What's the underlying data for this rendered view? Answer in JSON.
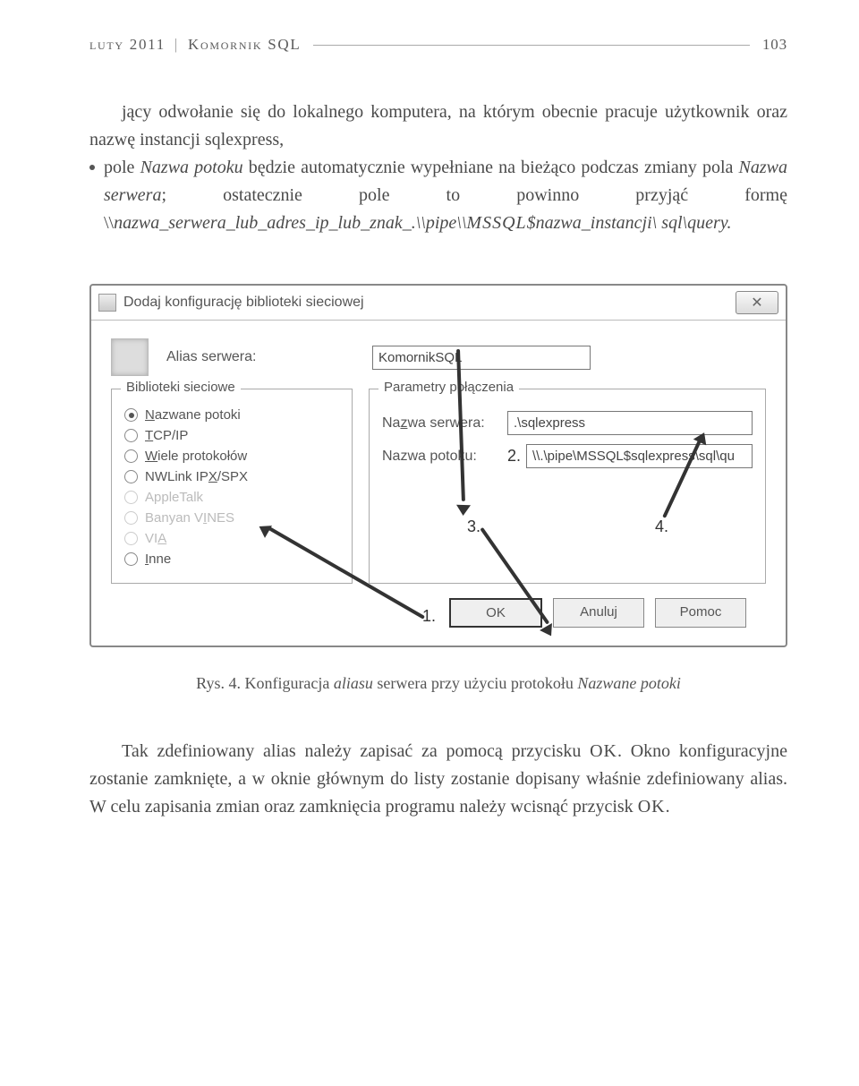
{
  "header": {
    "left": "luty 2011",
    "sep": "|",
    "title": "Komornik SQL",
    "page": "103"
  },
  "para1": "jący odwołanie się do lokalnego komputera, na którym obecnie pracuje użytkownik oraz nazwę instancji sqlexpress,",
  "bullet2_a": "pole ",
  "bullet2_b": "Nazwa potoku",
  "bullet2_c": " będzie automatycznie wypełniane na bieżąco podczas zmiany pola ",
  "bullet2_d": "Nazwa serwera",
  "bullet2_e": "; ostatecznie pole to powinno przyjąć formę \\\\",
  "bullet2_f": "nazwa_serwera_lub_adres_ip_lub_znak_.",
  "bullet2_g": "\\\\pipe\\\\",
  "bullet2_h": "MSSQL",
  "bullet2_i": "$nazwa_instancji",
  "bullet2_j": "\\ sql\\query.",
  "dialog": {
    "title": "Dodaj konfigurację biblioteki sieciowej",
    "aliasLabel": "Alias serwera:",
    "aliasValue": "KomornikSQL",
    "libsLegend": "Biblioteki sieciowe",
    "radios": {
      "r1": "Nazwane potoki",
      "r2": "TCP/IP",
      "r3": "Wiele protokołów",
      "r4": "NWLink IPX/SPX",
      "r5": "AppleTalk",
      "r6": "Banyan VINES",
      "r7": "VIA",
      "r8": "Inne"
    },
    "paramsLegend": "Parametry połączenia",
    "serverLabel": "Nazwa serwera:",
    "serverValue": ".\\sqlexpress",
    "pipeLabel": "Nazwa potoku:",
    "pipeValue": "\\\\.\\pipe\\MSSQL$sqlexpress\\sql\\qu",
    "ok": "OK",
    "cancel": "Anuluj",
    "help": "Pomoc",
    "ann1": "1.",
    "ann2": "2.",
    "ann3": "3.",
    "ann4": "4."
  },
  "caption_a": "Rys. 4. Konfiguracja ",
  "caption_b": "aliasu",
  "caption_c": " serwera przy użyciu protokołu ",
  "caption_d": "Nazwane potoki",
  "para2_a": "Tak zdefiniowany alias należy zapisać za pomocą przycisku ",
  "para2_b": "OK",
  "para2_c": ". Okno konfiguracyjne zostanie zamknięte, a w oknie głównym do listy zostanie dopisany właśnie zdefiniowany alias. W celu zapisania zmian oraz zamknięcia programu należy wcisnąć przycisk ",
  "para2_d": "OK",
  "para2_e": "."
}
